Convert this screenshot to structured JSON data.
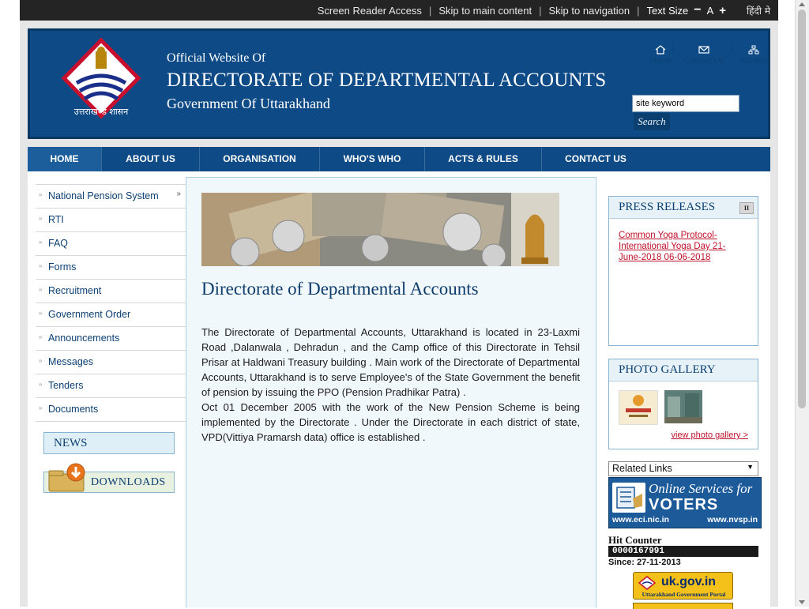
{
  "topbar": {
    "screen_reader": "Screen Reader Access",
    "skip_main": "Skip to main content",
    "skip_nav": "Skip to navigation",
    "text_size": "Text Size",
    "minus": "−",
    "a": "A",
    "plus": "+",
    "hindi": "हिंदी मे"
  },
  "header": {
    "logo_caption": "उत्तराखण्ड शासन",
    "line1": "Official Website Of",
    "line2": "DIRECTORATE OF DEPARTMENTAL ACCOUNTS",
    "line3": "Government Of Uttarakhand",
    "icons": [
      {
        "label": "Home",
        "icon": "home-icon"
      },
      {
        "label": "Contact Us",
        "icon": "mail-icon"
      },
      {
        "label": "Sitemap",
        "icon": "sitemap-icon"
      }
    ],
    "icon_separator": "|",
    "search_value": "site keyword",
    "search_button": "Search"
  },
  "nav": {
    "items": [
      "HOME",
      "ABOUT US",
      "ORGANISATION",
      "WHO'S WHO",
      "ACTS & RULES",
      "CONTACT US"
    ],
    "active": "HOME"
  },
  "sidebar": {
    "items": [
      {
        "label": "National Pension System",
        "has_submenu": true
      },
      {
        "label": "RTI"
      },
      {
        "label": "FAQ"
      },
      {
        "label": "Forms"
      },
      {
        "label": "Recruitment"
      },
      {
        "label": "Government Order"
      },
      {
        "label": "Announcements"
      },
      {
        "label": "Messages"
      },
      {
        "label": "Tenders"
      },
      {
        "label": "Documents"
      }
    ],
    "news": "NEWS",
    "downloads": "DOWNLOADS"
  },
  "main": {
    "title": "Directorate of Departmental Accounts",
    "paragraph1": "The Directorate of Departmental Accounts, Uttarakhand is located in 23-Laxmi Road ,Dalanwala , Dehradun , and the Camp office of  this Directorate in Tehsil Prisar  at  Haldwani Treasury building . Main work of the Directorate of Departmental Accounts, Uttarakhand is to serve Employee's of the State Government the benefit of  pension by issuing  the PPO (Pension Pradhikar Patra) .",
    "paragraph2": "Oct 01 December 2005 with the work of the New Pension Scheme is being implemented by the Directorate . Under the Directorate in each district of state, VPD(Vittiya Pramarsh data) office is established ."
  },
  "right": {
    "press_title": "PRESS RELEASES",
    "pause": "II",
    "press_item": "Common Yoga Protocol-International Yoga Day 21-June-2018 06-06-2018",
    "gallery_title": "PHOTO GALLERY",
    "view_gallery": "view photo gallery >",
    "related_links": "Related Links",
    "voters_line1": "Online Services for",
    "voters_line2": "VOTERS",
    "voters_url1": "www.eci.nic.in",
    "voters_url2": "www.nvsp.in",
    "hit_title": "Hit Counter",
    "hit_count": "0000167991",
    "hit_since": "Since: 27-11-2013",
    "ukgov_big": "uk.gov.in",
    "ukgov_small": "Uttarakhand Government Portal"
  },
  "colors": {
    "header_blue": "#0e4a85",
    "topbar": "#242424",
    "link_red": "#c0102a",
    "sidebar_link": "#0b3f73"
  }
}
